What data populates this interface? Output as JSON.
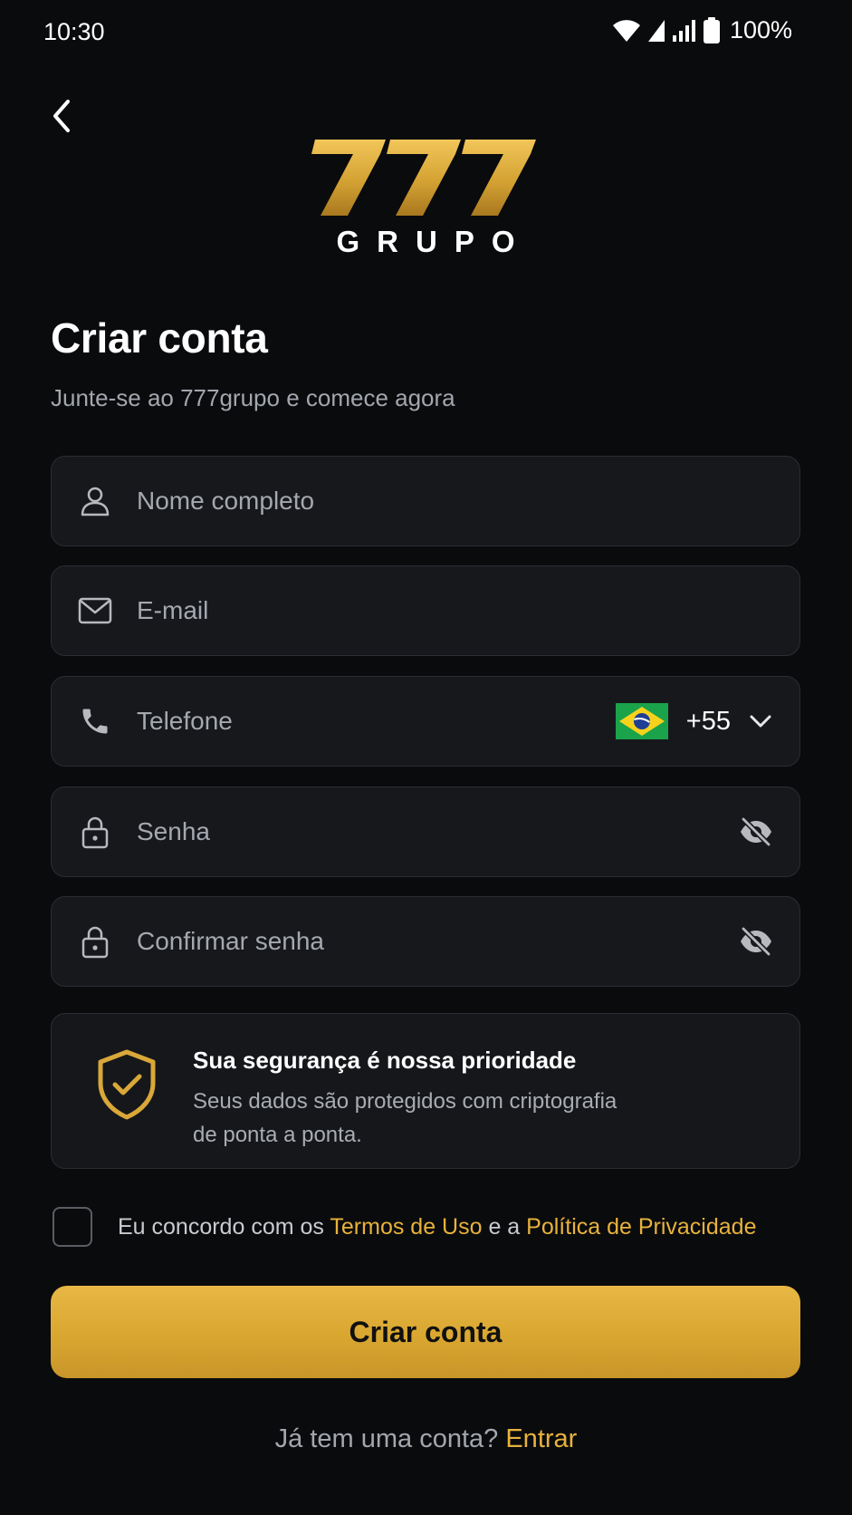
{
  "status_bar": {
    "time": "10:30",
    "battery": "100%"
  },
  "logo": {
    "numbers": "777",
    "word": "GRUPO"
  },
  "header": {
    "title": "Criar conta",
    "subtitle": "Junte-se ao 777grupo e comece agora"
  },
  "form": {
    "name_placeholder": "Nome completo",
    "email_placeholder": "E-mail",
    "phone_placeholder": "Telefone",
    "country_code": "+55",
    "password_placeholder": "Senha",
    "confirm_password_placeholder": "Confirmar senha"
  },
  "security": {
    "title": "Sua segurança é nossa prioridade",
    "text_line1": "Seus dados são protegidos com criptografia",
    "text_line2": "de ponta a ponta."
  },
  "terms": {
    "prefix": "Eu concordo com os ",
    "terms_link": "Termos de Uso",
    "middle": " e a ",
    "privacy_link": "Política de Privacidade"
  },
  "submit_label": "Criar conta",
  "login": {
    "prompt": "Já tem uma conta? ",
    "link": "Entrar"
  },
  "colors": {
    "accent": "#e7b23c",
    "background": "#0a0b0d",
    "field": "#16181c"
  }
}
